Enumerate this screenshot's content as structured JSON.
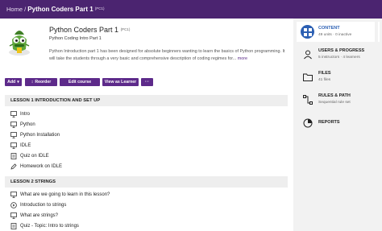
{
  "breadcrumb": {
    "home": "Home",
    "sep": "/",
    "current": "Python Coders Part 1",
    "code": "(PC1)"
  },
  "course": {
    "title": "Python Coders Part 1",
    "code": "(PC1)",
    "subtitle": "Python Coding Intro Part 1",
    "description": "Python Introduction part 1 has been designed for absolute beginners wanting to learn the basics of Python programming. It will take the students through a very basic and comprehensive description of coding regimes for...",
    "more": "more"
  },
  "toolbar": {
    "add": "Add",
    "reorder": "Reorder",
    "edit": "Edit course",
    "view": "View as Learner",
    "more": "···"
  },
  "lessons": [
    {
      "title": "LESSON 1 INTRODUCTION AND SET UP",
      "items": [
        {
          "label": "Intro",
          "icon": "presentation-icon"
        },
        {
          "label": "Python",
          "icon": "presentation-icon"
        },
        {
          "label": "Python Installation",
          "icon": "presentation-icon"
        },
        {
          "label": "IDLE",
          "icon": "presentation-icon"
        },
        {
          "label": "Quiz on IDLE",
          "icon": "quiz-icon"
        },
        {
          "label": "Homework on IDLE",
          "icon": "pencil-icon"
        }
      ]
    },
    {
      "title": "LESSON 2 STRINGS",
      "items": [
        {
          "label": "What are we going to learn in this lesson?",
          "icon": "presentation-icon"
        },
        {
          "label": "Introduction to strings",
          "icon": "play-icon"
        },
        {
          "label": "What are strings?",
          "icon": "presentation-icon"
        },
        {
          "label": "Quiz - Topic: Intro to strings",
          "icon": "quiz-icon"
        }
      ]
    }
  ],
  "sidebar": [
    {
      "title": "CONTENT",
      "sub": "49 units · 0 inactive",
      "icon": "grid-icon",
      "active": true
    },
    {
      "title": "USERS & PROGRESS",
      "sub": "5 instructors · 4 learners",
      "icon": "users-icon",
      "active": false
    },
    {
      "title": "FILES",
      "sub": "41 files",
      "icon": "folder-icon",
      "active": false
    },
    {
      "title": "RULES & PATH",
      "sub": "Sequential rule set",
      "icon": "path-icon",
      "active": false
    },
    {
      "title": "REPORTS",
      "sub": "",
      "icon": "pie-icon",
      "active": false
    }
  ],
  "colors": {
    "topbar": "#4b2470",
    "button": "#5d2a8a",
    "accent": "#2b5fb3",
    "sidebar_bg": "#f2f2f2"
  }
}
